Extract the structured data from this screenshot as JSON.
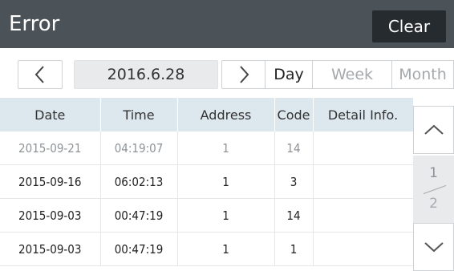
{
  "header": {
    "title": "Error",
    "clear_label": "Clear"
  },
  "toolbar": {
    "date": "2016.6.28",
    "periods": [
      {
        "label": "Day",
        "active": true
      },
      {
        "label": "Week",
        "active": false
      },
      {
        "label": "Month",
        "active": false
      }
    ]
  },
  "table": {
    "columns": [
      "Date",
      "Time",
      "Address",
      "Code",
      "Detail Info."
    ],
    "rows": [
      {
        "date": "2015-09-21",
        "time": "04:19:07",
        "address": "1",
        "code": "14",
        "detail": "",
        "dimmed": true
      },
      {
        "date": "2015-09-16",
        "time": "06:02:13",
        "address": "1",
        "code": "3",
        "detail": "",
        "dimmed": false
      },
      {
        "date": "2015-09-03",
        "time": "00:47:19",
        "address": "1",
        "code": "14",
        "detail": "",
        "dimmed": false
      },
      {
        "date": "2015-09-03",
        "time": "00:47:19",
        "address": "1",
        "code": "1",
        "detail": "",
        "dimmed": false
      }
    ]
  },
  "pager": {
    "current": "1",
    "total": "2"
  },
  "icons": {
    "prev": "chevron-left-icon",
    "next": "chevron-right-icon",
    "up": "chevron-up-icon",
    "down": "chevron-down-icon"
  },
  "colors": {
    "header_bg": "#4b5358",
    "clear_bg": "#262b2f",
    "table_header_bg": "#dde7ee"
  }
}
